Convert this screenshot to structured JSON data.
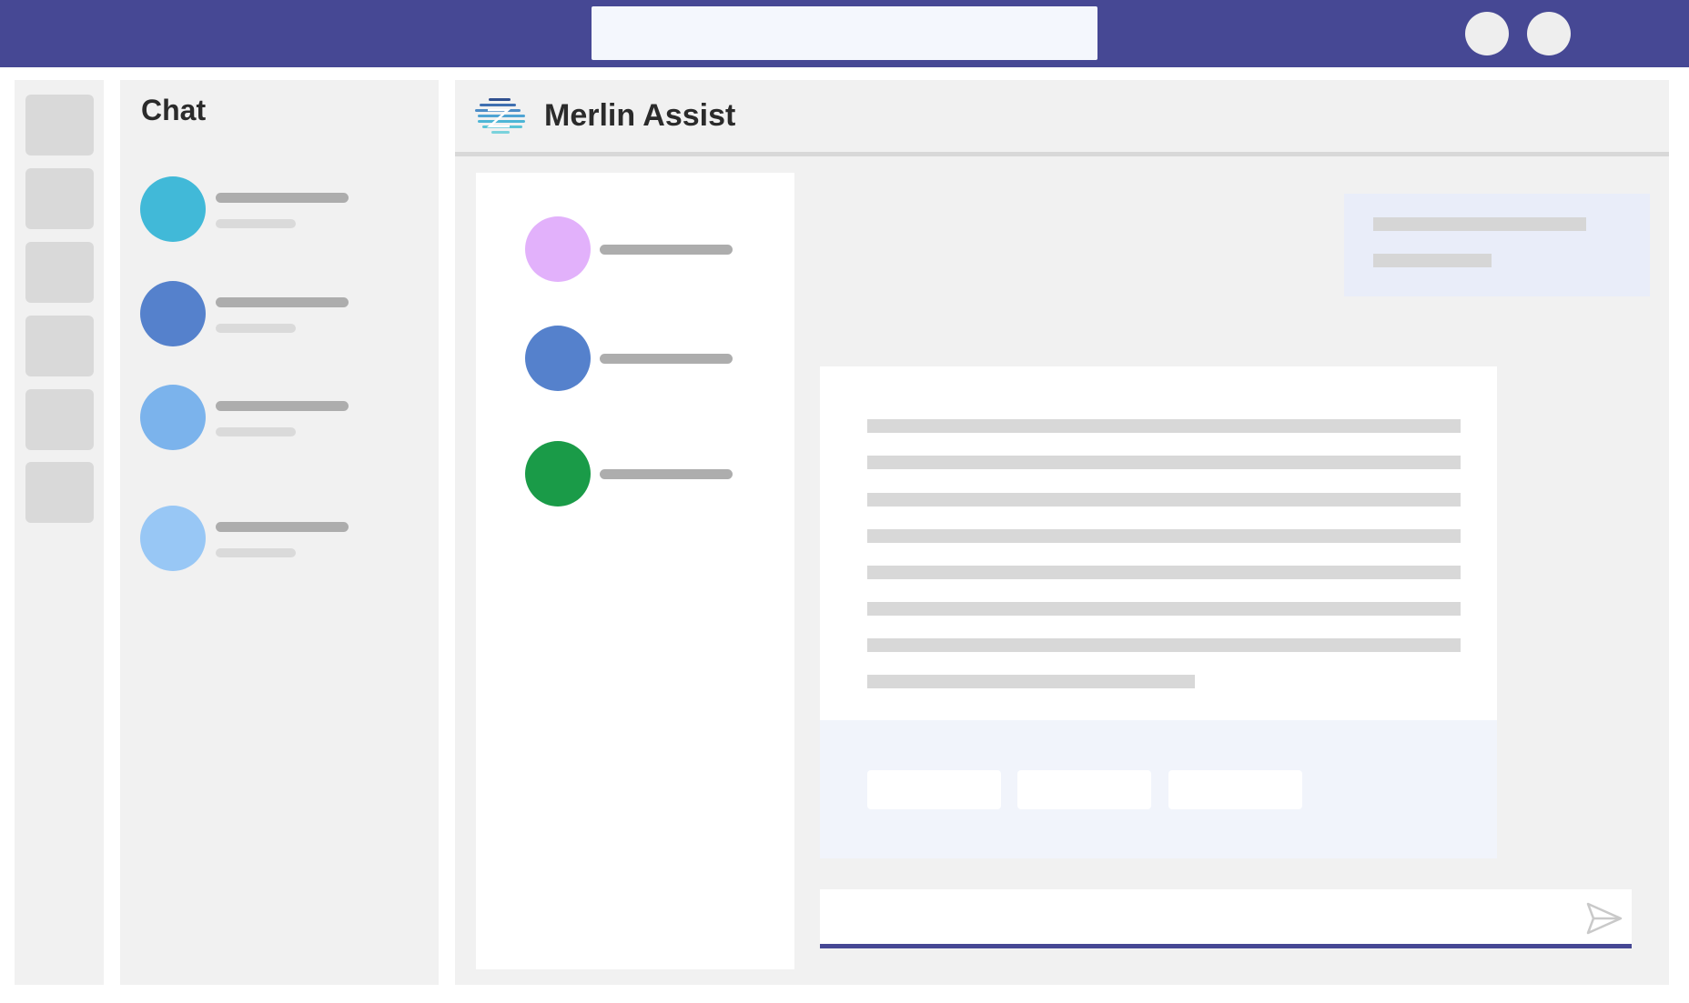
{
  "chat_panel": {
    "title": "Chat"
  },
  "app": {
    "title": "Merlin Assist",
    "logo_icon": "merlin-logo-icon"
  },
  "composer": {
    "send_icon": "send-icon"
  },
  "colors": {
    "topbar": "#464894",
    "chat_avatars": [
      "#41b9d8",
      "#5581cc",
      "#7bb3ec",
      "#98c7f5"
    ],
    "conversation_avatars": [
      "#e2b1fb",
      "#5581cc",
      "#1a9b48"
    ]
  }
}
